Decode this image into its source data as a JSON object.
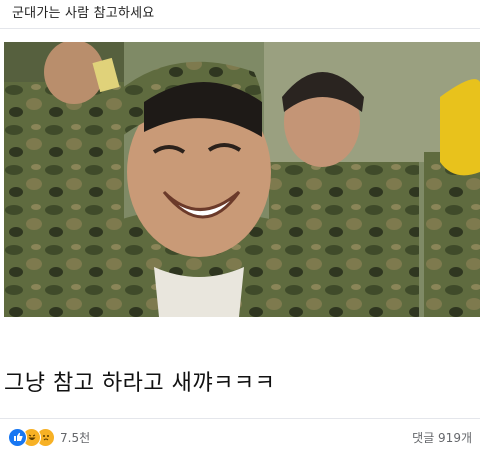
{
  "post": {
    "title": "군대가는 사람 참고하세요",
    "headline": "그냥 참고 하라고 새꺄ㅋㅋㅋ"
  },
  "footer": {
    "reactions": [
      "like-icon",
      "haha-icon",
      "sad-icon"
    ],
    "reaction_count": "7.5천",
    "comments": "댓글 919개"
  },
  "colors": {
    "like": "#1877f2",
    "emoji": "#f7b125",
    "muted_text": "#65676b"
  }
}
